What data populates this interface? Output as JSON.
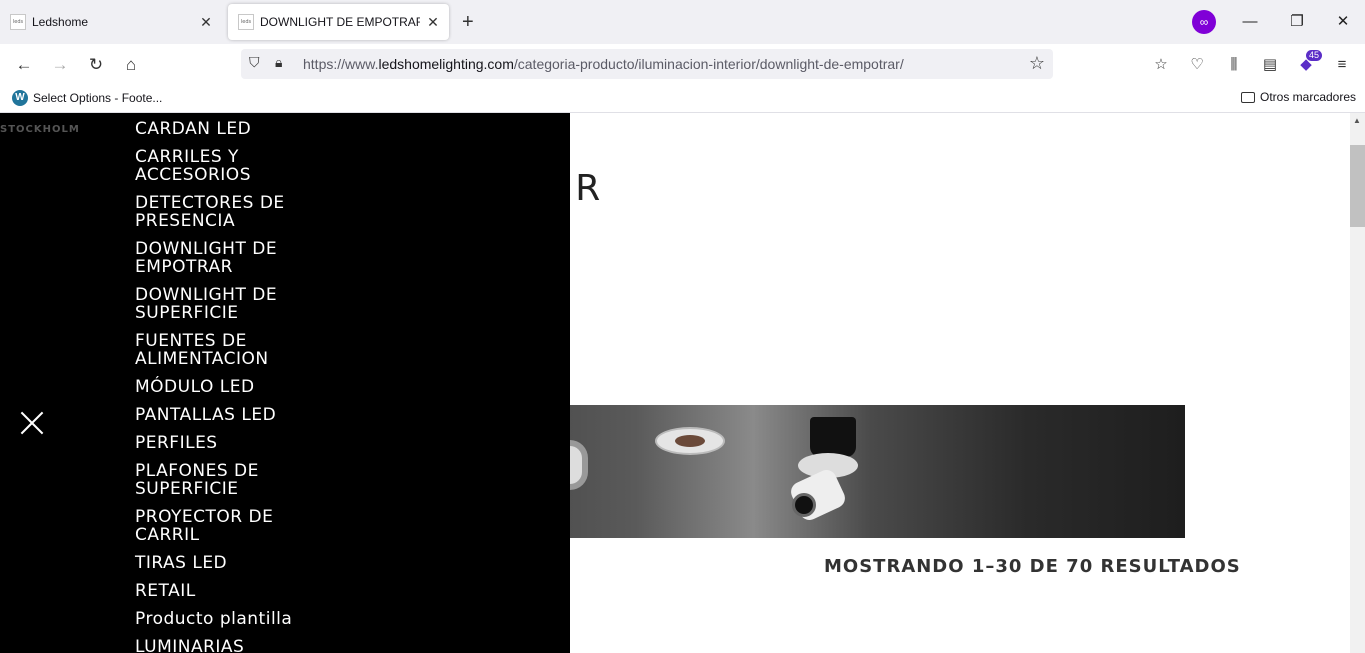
{
  "browser": {
    "tabs": [
      {
        "title": "Ledshome",
        "favicon": "leds"
      },
      {
        "title": "DOWNLIGHT DE EMPOTRAR – L",
        "favicon": "leds"
      }
    ],
    "url_prefix": "https://www.",
    "url_domain": "ledshomelighting.com",
    "url_path": "/categoria-producto/iluminacion-interior/downlight-de-empotrar/",
    "extension_badge": "45",
    "bookmarks": [
      {
        "label": "Select Options - Foote..."
      }
    ],
    "other_bookmarks": "Otros marcadores"
  },
  "page": {
    "title_visible": "POTRAR",
    "results_text": "MOSTRANDO 1–30 DE 70 RESULTADOS"
  },
  "menu": {
    "brand": "STOCKHOLM",
    "items": [
      "CARDAN LED",
      "CARRILES Y\nACCESORIOS",
      "DETECTORES DE\nPRESENCIA",
      "DOWNLIGHT DE\nEMPOTRAR",
      "DOWNLIGHT DE\nSUPERFICIE",
      "FUENTES DE\nALIMENTACION",
      "MÓDULO LED",
      "PANTALLAS LED",
      "PERFILES",
      "PLAFONES DE\nSUPERFICIE",
      "PROYECTOR DE\nCARRIL",
      "TIRAS LED",
      "RETAIL",
      "Producto plantilla",
      "LUMINARIAS"
    ]
  }
}
